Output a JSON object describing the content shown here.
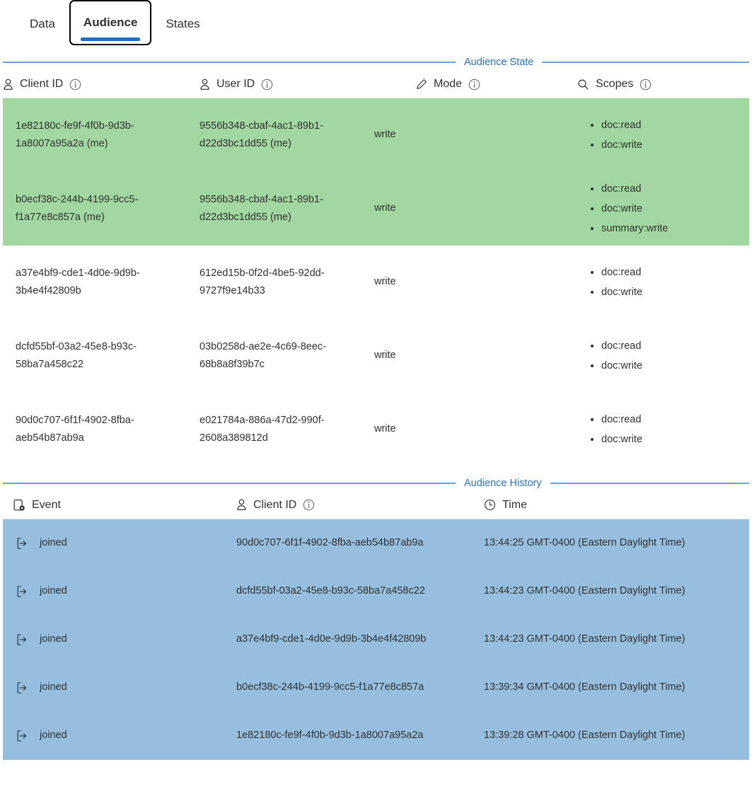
{
  "tabs": [
    {
      "label": "Data",
      "selected": false
    },
    {
      "label": "Audience",
      "selected": true
    },
    {
      "label": "States",
      "selected": false
    }
  ],
  "colors": {
    "accent_blue": "#2a72c0",
    "legend_line": "#6aa3d8",
    "row_highlight_green": "#a1d8a1",
    "row_highlight_blue": "#96bfdf",
    "tab_indicator": "#1f6fc4"
  },
  "audience_state": {
    "legend": "Audience State",
    "columns": [
      {
        "label": "Client ID",
        "icon": "person-icon",
        "info": true
      },
      {
        "label": "User ID",
        "icon": "person-icon",
        "info": true
      },
      {
        "label": "Mode",
        "icon": "pencil-icon",
        "info": true
      },
      {
        "label": "Scopes",
        "icon": "search-icon",
        "info": true
      }
    ],
    "rows": [
      {
        "client_id": "1e82180c-fe9f-4f0b-9d3b-1a8007a95a2a (me)",
        "user_id": "9556b348-cbaf-4ac1-89b1-d22d3bc1dd55 (me)",
        "mode": "write",
        "scopes": [
          "doc:read",
          "doc:write"
        ],
        "highlight": "green"
      },
      {
        "client_id": "b0ecf38c-244b-4199-9cc5-f1a77e8c857a (me)",
        "user_id": "9556b348-cbaf-4ac1-89b1-d22d3bc1dd55 (me)",
        "mode": "write",
        "scopes": [
          "doc:read",
          "doc:write",
          "summary:write"
        ],
        "highlight": "green"
      },
      {
        "client_id": "a37e4bf9-cde1-4d0e-9d9b-3b4e4f42809b",
        "user_id": "612ed15b-0f2d-4be5-92dd-9727f9e14b33",
        "mode": "write",
        "scopes": [
          "doc:read",
          "doc:write"
        ],
        "highlight": "none"
      },
      {
        "client_id": "dcfd55bf-03a2-45e8-b93c-58ba7a458c22",
        "user_id": "03b0258d-ae2e-4c69-8eec-68b8a8f39b7c",
        "mode": "write",
        "scopes": [
          "doc:read",
          "doc:write"
        ],
        "highlight": "none"
      },
      {
        "client_id": "90d0c707-6f1f-4902-8fba-aeb54b87ab9a",
        "user_id": "e021784a-886a-47d2-990f-2608a389812d",
        "mode": "write",
        "scopes": [
          "doc:read",
          "doc:write"
        ],
        "highlight": "none"
      }
    ]
  },
  "audience_history": {
    "legend": "Audience History",
    "columns": [
      {
        "label": "Event",
        "icon": "event-device-icon",
        "info": false
      },
      {
        "label": "Client ID",
        "icon": "person-icon",
        "info": true
      },
      {
        "label": "Time",
        "icon": "clock-icon",
        "info": false
      }
    ],
    "rows": [
      {
        "event": "joined",
        "event_icon": "sign-in-icon",
        "client_id": "90d0c707-6f1f-4902-8fba-aeb54b87ab9a",
        "time": "13:44:25 GMT-0400 (Eastern Daylight Time)",
        "highlight": "blue"
      },
      {
        "event": "joined",
        "event_icon": "sign-in-icon",
        "client_id": "dcfd55bf-03a2-45e8-b93c-58ba7a458c22",
        "time": "13:44:23 GMT-0400 (Eastern Daylight Time)",
        "highlight": "blue"
      },
      {
        "event": "joined",
        "event_icon": "sign-in-icon",
        "client_id": "a37e4bf9-cde1-4d0e-9d9b-3b4e4f42809b",
        "time": "13:44:23 GMT-0400 (Eastern Daylight Time)",
        "highlight": "blue"
      },
      {
        "event": "joined",
        "event_icon": "sign-in-icon",
        "client_id": "b0ecf38c-244b-4199-9cc5-f1a77e8c857a",
        "time": "13:39:34 GMT-0400 (Eastern Daylight Time)",
        "highlight": "blue"
      },
      {
        "event": "joined",
        "event_icon": "sign-in-icon",
        "client_id": "1e82180c-fe9f-4f0b-9d3b-1a8007a95a2a",
        "time": "13:39:28 GMT-0400 (Eastern Daylight Time)",
        "highlight": "blue"
      }
    ]
  }
}
